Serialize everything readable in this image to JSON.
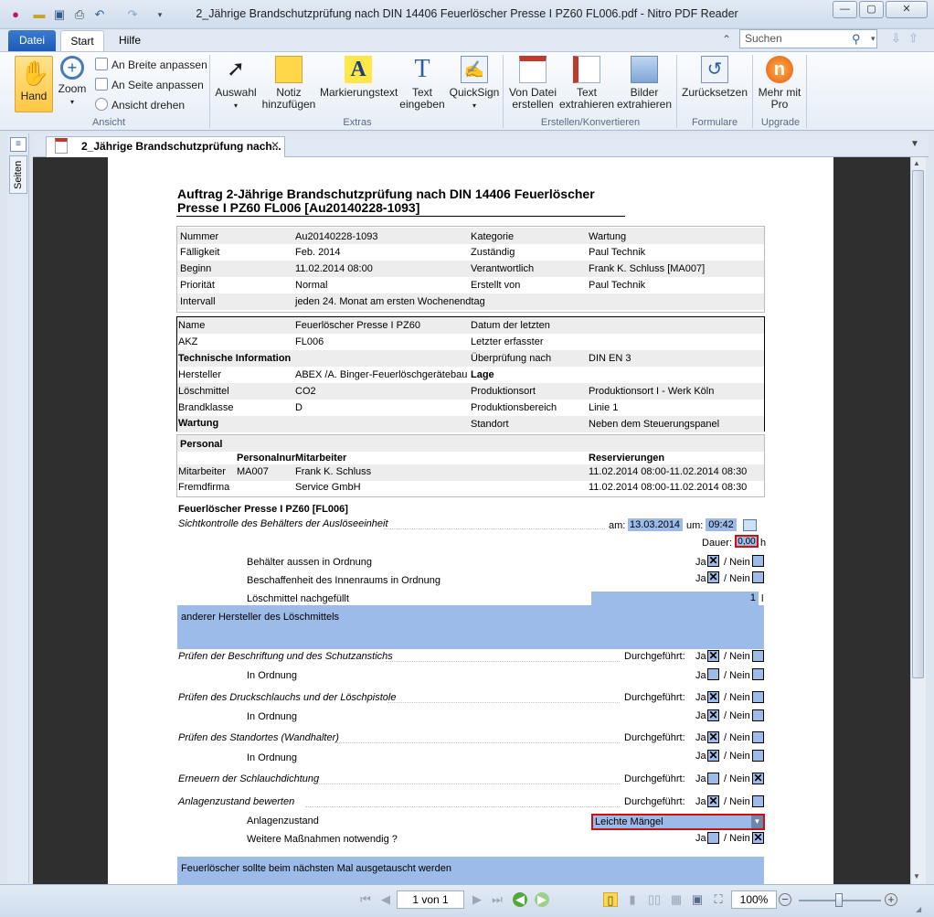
{
  "window": {
    "title": "2_Jährige Brandschutzprüfung nach DIN 14406 Feuerlöscher Presse I PZ60 FL006.pdf - Nitro PDF Reader"
  },
  "tabs": {
    "file": "Datei",
    "start": "Start",
    "help": "Hilfe"
  },
  "search": {
    "placeholder": "Suchen"
  },
  "ribbon": {
    "hand": "Hand",
    "zoom": "Zoom",
    "fit_width": "An Breite anpassen",
    "fit_page": "An Seite anpassen",
    "rotate": "Ansicht drehen",
    "group_view": "Ansicht",
    "select": "Auswahl",
    "note": "Notiz hinzufügen",
    "highlight": "Markierungstext",
    "text": "Text eingeben",
    "quicksign": "QuickSign",
    "group_extras": "Extras",
    "from_file": "Von Datei erstellen",
    "extract_text": "Text extrahieren",
    "extract_images": "Bilder extrahieren",
    "group_create": "Erstellen/Konvertieren",
    "reset": "Zurücksetzen",
    "group_forms": "Formulare",
    "more": "Mehr mit Pro",
    "group_upgrade": "Upgrade"
  },
  "sidebar": {
    "pages": "Seiten"
  },
  "doc_tab": {
    "label": "2_Jährige Brandschutzprüfung nach..."
  },
  "doc": {
    "title1": "Auftrag 2-Jährige Brandschutzprüfung nach DIN 14406 Feuerlöscher",
    "title2": "Presse I PZ60 FL006 [Au20140228-1093]",
    "info": [
      [
        "Nummer",
        "Au20140228-1093",
        "Kategorie",
        "Wartung"
      ],
      [
        "Fälligkeit",
        "Feb. 2014",
        "Zuständig",
        "Paul Technik"
      ],
      [
        "Beginn",
        "11.02.2014 08:00",
        "Verantwortlich",
        "Frank K. Schluss [MA007]"
      ],
      [
        "Priorität",
        "Normal",
        "Erstellt von",
        "Paul Technik"
      ],
      [
        "Intervall",
        "jeden 24. Monat am ersten Wochenendtag",
        "",
        ""
      ]
    ],
    "asset": {
      "name_l": "Name",
      "name_v": "Feuerlöscher Presse I PZ60",
      "last_l": "Datum der letzten",
      "akz_l": "AKZ",
      "akz_v": "FL006",
      "last2_l": "Letzter erfasster",
      "tech": "Technische Information",
      "check_l": "Überprüfung nach",
      "check_v": "DIN EN 3",
      "maker_l": "Hersteller",
      "maker_v": "ABEX /A. Binger-Feuerlöschgerätebau",
      "lage": "Lage",
      "agent_l": "Löschmittel",
      "agent_v": "CO2",
      "site_l": "Produktionsort",
      "site_v": "Produktionsort I - Werk Köln",
      "class_l": "Brandklasse",
      "class_v": "D",
      "area_l": "Produktionsbereich",
      "area_v": "Linie 1",
      "wartung": "Wartung",
      "loc_l": "Standort",
      "loc_v": "Neben dem Steuerungspanel"
    },
    "personal": {
      "title": "Personal",
      "h1": "Personalnur",
      "h2": "Mitarbeiter",
      "h3": "Reservierungen",
      "r1": [
        "Mitarbeiter",
        "MA007",
        "Frank K. Schluss",
        "11.02.2014 08:00-11.02.2014 08:30"
      ],
      "r2": [
        "Fremdfirma",
        "",
        "Service GmbH",
        "11.02.2014 08:00-11.02.2014 08:30"
      ]
    },
    "section": "Feuerlöscher Presse I PZ60 [FL006]",
    "visual": "Sichtkontrolle des Behälters der Auslöseeinheit",
    "am": "am:",
    "date": "13.03.2014",
    "um": "um:",
    "time": "09:42",
    "dauer": "Dauer:",
    "dauer_v": "0,00",
    "h": "h",
    "ja": "Ja",
    "nein": "/ Nein",
    "done": "Durchgeführt:",
    "items": {
      "a1": "Behälter aussen in Ordnung",
      "a2": "Beschaffenheit des Innenraums in Ordnung",
      "a3": "Löschmittel nachgefüllt",
      "a3v": "1",
      "a3u": "l",
      "a4": "anderer Hersteller des Löschmittels",
      "b1": "Prüfen der Beschriftung und des Schutzanstichs",
      "ok": "In Ordnung",
      "b2": "Prüfen des Druckschlauchs und der Löschpistole",
      "b3": "Prüfen des Standortes (Wandhalter)",
      "b4": "Erneuern der Schlauchdichtung",
      "b5": "Anlagenzustand bewerten",
      "b6": "Anlagenzustand",
      "b6v": "Leichte Mängel",
      "b7": "Weitere Maßnahmen notwendig ?",
      "note": "Feuerlöscher sollte beim nächsten Mal ausgetauscht werden"
    }
  },
  "status": {
    "page": "1 von 1",
    "zoom": "100%"
  }
}
